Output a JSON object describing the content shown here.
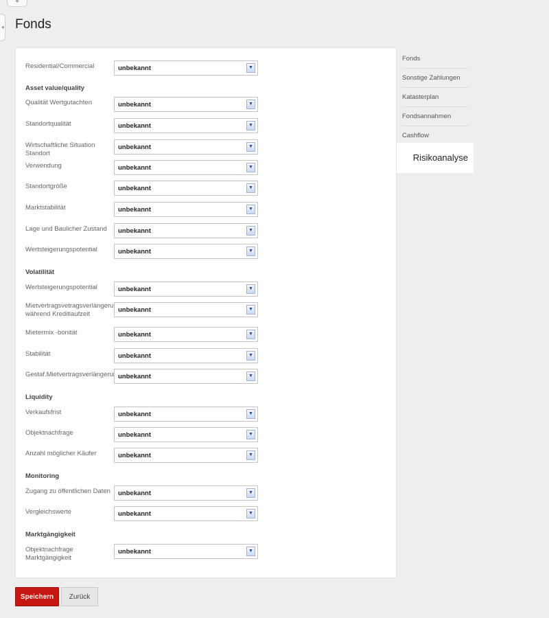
{
  "top_tab_icon": "plus-icon",
  "side_tab_icon": "plus-icon",
  "page_title": "Fonds",
  "nav": {
    "items": [
      {
        "label": "Fonds"
      },
      {
        "label": "Sonstige Zahlungen"
      },
      {
        "label": "Katasterplan"
      },
      {
        "label": "Fondsannahmen"
      },
      {
        "label": "Cashflow"
      }
    ],
    "active": "Risikoanalyse"
  },
  "form": {
    "select_value": "unbekannt",
    "fields": {
      "residential": "Residential/Commercial",
      "qualitaet_wertgutachten": "Qualität Wertgutachten",
      "standortqualitaet": "Standortqualität",
      "wirtschaftliche_situation": "Wirtschaftliche Situation Standort",
      "verwendung": "Verwendung",
      "standortgroesse": "Standortgröße",
      "marktstabilitaet": "Marktstabilität",
      "lage_baulicher_zustand": "Lage und Baulicher Zustand",
      "wertsteigerungspotential_1": "Wertsteigerungspotential",
      "wertsteigerungspotential_2": "Wertsteigerungspotential",
      "mietvertrag_verlaengerung": "Mietvertragsvetragsverlängerung während Kreditlaufzeit",
      "mietermix": "Mietermix -bonität",
      "stabilitaet": "Stabilität",
      "gestaf_mietvertrag": "Gestaf.Mietvertragsverlängerung",
      "verkaufsfrist": "Verkaufsfrist",
      "objektnachfrage": "Objektnachfrage",
      "anzahl_kaeufer": "Anzahl möglicher Käufer",
      "zugang_daten": "Zugang zu öffentlichen Daten",
      "vergleichswerte": "Vergleichswerte",
      "objektnachfrage_markt": "Objektnachfrage Marktgängigkeit"
    },
    "sections": {
      "asset": "Asset value/quality",
      "volatilitaet": "Volatilität",
      "liquidity": "Liquidity",
      "monitoring": "Monitoring",
      "marktgaengigkeit": "Marktgängigkeit"
    }
  },
  "buttons": {
    "save": "Speichern",
    "back": "Zurück"
  }
}
